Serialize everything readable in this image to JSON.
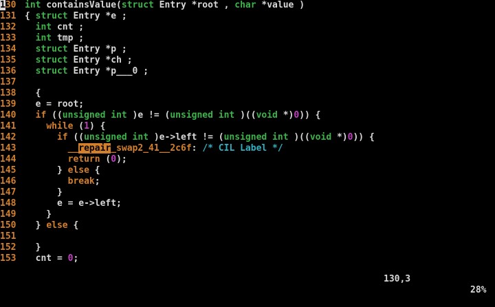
{
  "editor": {
    "lines": [
      {
        "num": "130",
        "cursor_digit": "1",
        "num_rest": "30",
        "segments": [
          {
            "t": "int",
            "c": "type"
          },
          {
            "t": " containsValue(",
            "c": "plain"
          },
          {
            "t": "struct",
            "c": "type"
          },
          {
            "t": " Entry *root , ",
            "c": "plain"
          },
          {
            "t": "char",
            "c": "type"
          },
          {
            "t": " *value )",
            "c": "plain"
          }
        ]
      },
      {
        "num": "131",
        "segments": [
          {
            "t": "{ ",
            "c": "plain"
          },
          {
            "t": "struct",
            "c": "type"
          },
          {
            "t": " Entry *e ;",
            "c": "plain"
          }
        ]
      },
      {
        "num": "132",
        "segments": [
          {
            "t": "  ",
            "c": "plain"
          },
          {
            "t": "int",
            "c": "type"
          },
          {
            "t": " cnt ;",
            "c": "plain"
          }
        ]
      },
      {
        "num": "133",
        "segments": [
          {
            "t": "  ",
            "c": "plain"
          },
          {
            "t": "int",
            "c": "type"
          },
          {
            "t": " tmp ;",
            "c": "plain"
          }
        ]
      },
      {
        "num": "134",
        "segments": [
          {
            "t": "  ",
            "c": "plain"
          },
          {
            "t": "struct",
            "c": "type"
          },
          {
            "t": " Entry *p ;",
            "c": "plain"
          }
        ]
      },
      {
        "num": "135",
        "segments": [
          {
            "t": "  ",
            "c": "plain"
          },
          {
            "t": "struct",
            "c": "type"
          },
          {
            "t": " Entry *ch ;",
            "c": "plain"
          }
        ]
      },
      {
        "num": "136",
        "segments": [
          {
            "t": "  ",
            "c": "plain"
          },
          {
            "t": "struct",
            "c": "type"
          },
          {
            "t": " Entry *p___0 ;",
            "c": "plain"
          }
        ]
      },
      {
        "num": "137",
        "segments": []
      },
      {
        "num": "138",
        "segments": [
          {
            "t": "  {",
            "c": "plain"
          }
        ]
      },
      {
        "num": "139",
        "segments": [
          {
            "t": "  e = root;",
            "c": "plain"
          }
        ]
      },
      {
        "num": "140",
        "segments": [
          {
            "t": "  ",
            "c": "plain"
          },
          {
            "t": "if",
            "c": "keyword"
          },
          {
            "t": " ((",
            "c": "plain"
          },
          {
            "t": "unsigned int",
            "c": "type"
          },
          {
            "t": " )e != (",
            "c": "plain"
          },
          {
            "t": "unsigned int",
            "c": "type"
          },
          {
            "t": " )((",
            "c": "plain"
          },
          {
            "t": "void",
            "c": "type"
          },
          {
            "t": " *)",
            "c": "plain"
          },
          {
            "t": "0",
            "c": "number"
          },
          {
            "t": ")) {",
            "c": "plain"
          }
        ]
      },
      {
        "num": "141",
        "segments": [
          {
            "t": "    ",
            "c": "plain"
          },
          {
            "t": "while",
            "c": "keyword"
          },
          {
            "t": " (",
            "c": "plain"
          },
          {
            "t": "1",
            "c": "number"
          },
          {
            "t": ") {",
            "c": "plain"
          }
        ]
      },
      {
        "num": "142",
        "segments": [
          {
            "t": "      ",
            "c": "plain"
          },
          {
            "t": "if",
            "c": "keyword"
          },
          {
            "t": " ((",
            "c": "plain"
          },
          {
            "t": "unsigned int",
            "c": "type"
          },
          {
            "t": " )e->left != (",
            "c": "plain"
          },
          {
            "t": "unsigned int",
            "c": "type"
          },
          {
            "t": " )((",
            "c": "plain"
          },
          {
            "t": "void",
            "c": "type"
          },
          {
            "t": " *)",
            "c": "plain"
          },
          {
            "t": "0",
            "c": "number"
          },
          {
            "t": ")) {",
            "c": "plain"
          }
        ]
      },
      {
        "num": "143",
        "segments": [
          {
            "t": "        ",
            "c": "plain"
          },
          {
            "t": "__",
            "c": "label"
          },
          {
            "t": "repair",
            "c": "search"
          },
          {
            "t": "_swap2_41__2c6f",
            "c": "label"
          },
          {
            "t": ": ",
            "c": "plain"
          },
          {
            "t": "/* CIL Label */",
            "c": "comment"
          }
        ]
      },
      {
        "num": "144",
        "segments": [
          {
            "t": "        ",
            "c": "plain"
          },
          {
            "t": "return",
            "c": "keyword"
          },
          {
            "t": " (",
            "c": "plain"
          },
          {
            "t": "0",
            "c": "number"
          },
          {
            "t": ");",
            "c": "plain"
          }
        ]
      },
      {
        "num": "145",
        "segments": [
          {
            "t": "      } ",
            "c": "plain"
          },
          {
            "t": "else",
            "c": "keyword"
          },
          {
            "t": " {",
            "c": "plain"
          }
        ]
      },
      {
        "num": "146",
        "segments": [
          {
            "t": "        ",
            "c": "plain"
          },
          {
            "t": "break",
            "c": "keyword"
          },
          {
            "t": ";",
            "c": "plain"
          }
        ]
      },
      {
        "num": "147",
        "segments": [
          {
            "t": "      }",
            "c": "plain"
          }
        ]
      },
      {
        "num": "148",
        "segments": [
          {
            "t": "      e = e->left;",
            "c": "plain"
          }
        ]
      },
      {
        "num": "149",
        "segments": [
          {
            "t": "    }",
            "c": "plain"
          }
        ]
      },
      {
        "num": "150",
        "segments": [
          {
            "t": "  } ",
            "c": "plain"
          },
          {
            "t": "else",
            "c": "keyword"
          },
          {
            "t": " {",
            "c": "plain"
          }
        ]
      },
      {
        "num": "151",
        "segments": []
      },
      {
        "num": "152",
        "segments": [
          {
            "t": "  }",
            "c": "plain"
          }
        ]
      },
      {
        "num": "153",
        "segments": [
          {
            "t": "  cnt = ",
            "c": "plain"
          },
          {
            "t": "0",
            "c": "number"
          },
          {
            "t": ";",
            "c": "plain"
          }
        ]
      }
    ]
  },
  "status_bar": {
    "cursor_position": "130,3",
    "scroll_percent": "28%"
  },
  "colors": {
    "background": "#000000",
    "plain": "#d8d8d8",
    "line_number": "#d4802a",
    "type": "#3cb44a",
    "keyword": "#d4802a",
    "number": "#c040c0",
    "label": "#d4802a",
    "comment": "#30b0c0",
    "search_bg": "#d4802a",
    "search_fg": "#000000"
  }
}
